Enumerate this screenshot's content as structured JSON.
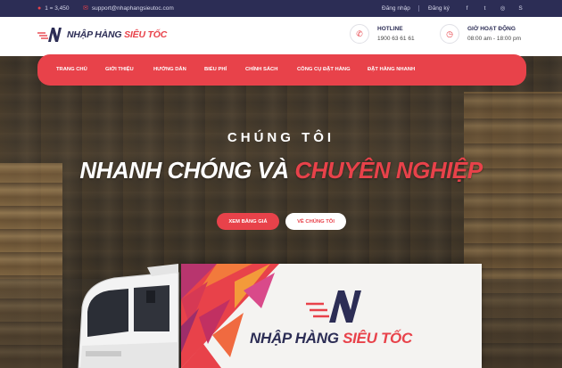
{
  "topbar": {
    "phone": "1 = 3,450",
    "email": "support@nhaphangsieutoc.com",
    "login": "Đăng nhập",
    "register": "Đăng ký",
    "social": [
      "facebook-icon",
      "twitter-icon",
      "instagram-icon",
      "skype-icon"
    ]
  },
  "header": {
    "logo_main": "NHẬP HÀNG",
    "logo_accent": "SIÊU TỐC",
    "hotline_label": "HOTLINE",
    "hotline_value": "1900 63 61 61",
    "hours_label": "GIỜ HOẠT ĐỘNG",
    "hours_value": "08:00 am - 18:00 pm"
  },
  "nav": {
    "items": [
      "TRANG CHỦ",
      "GIỚI THIỆU",
      "HƯỚNG DẪN",
      "BIỂU PHÍ",
      "CHÍNH SÁCH",
      "CÔNG CỤ ĐẶT HÀNG",
      "ĐẶT HÀNG NHANH"
    ]
  },
  "hero": {
    "subtitle": "CHÚNG TÔI",
    "title_main": "NHANH CHÓNG VÀ",
    "title_accent": "CHUYÊN NGHIỆP",
    "btn_price": "XEM BẢNG GIÁ",
    "btn_about": "VỀ CHÚNG TÔI"
  },
  "truck": {
    "logo_main": "NHẬP HÀNG",
    "logo_accent": "SIÊU TỐC"
  },
  "colors": {
    "brand_navy": "#2c2d55",
    "brand_red": "#e8424a"
  }
}
